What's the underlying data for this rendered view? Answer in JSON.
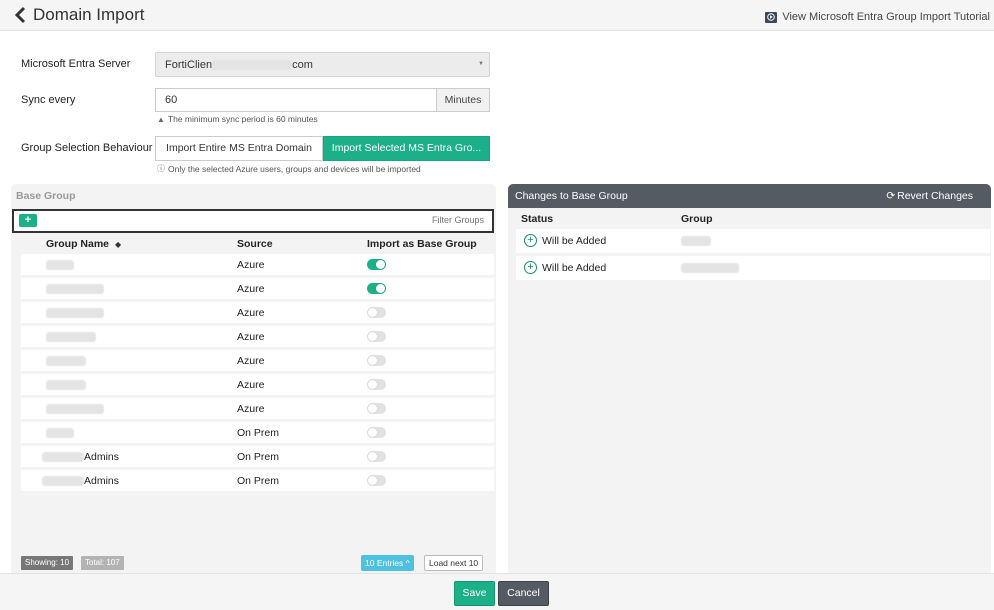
{
  "header": {
    "title": "Domain Import",
    "tutorial_link": "View Microsoft Entra Group Import Tutorial"
  },
  "form": {
    "server_label": "Microsoft Entra Server",
    "server_value_prefix": "FortiClien",
    "server_value_suffix": "com",
    "sync_label": "Sync every",
    "sync_value": "60",
    "sync_unit": "Minutes",
    "sync_hint": "The minimum sync period is 60 minutes",
    "behaviour_label": "Group Selection Behaviour",
    "behaviour_options": [
      "Import Entire MS Entra Domain",
      "Import Selected MS Entra Gro..."
    ],
    "behaviour_selected": "Import Selected MS Entra Gro...",
    "behaviour_hint": "Only the selected Azure users, groups and devices will be imported"
  },
  "base_group": {
    "title": "Base Group",
    "filter_placeholder": "Filter Groups",
    "columns": [
      "Group Name",
      "Source",
      "Import as Base Group"
    ],
    "rows": [
      {
        "name": "",
        "source": "Azure",
        "import": true
      },
      {
        "name": "",
        "source": "Azure",
        "import": true
      },
      {
        "name": "",
        "source": "Azure",
        "import": false
      },
      {
        "name": "",
        "source": "Azure",
        "import": false
      },
      {
        "name": "",
        "source": "Azure",
        "import": false
      },
      {
        "name": "",
        "source": "Azure",
        "import": false
      },
      {
        "name": "",
        "source": "Azure",
        "import": false
      },
      {
        "name": "",
        "source": "On Prem",
        "import": false
      },
      {
        "name": "Admins",
        "source": "On Prem",
        "import": false
      },
      {
        "name": "Admins",
        "source": "On Prem",
        "import": false
      }
    ],
    "showing": "Showing: 10",
    "total": "Total: 107",
    "entries": "10 Entries",
    "load_next": "Load next 10"
  },
  "changes": {
    "title": "Changes to Base Group",
    "revert": "Revert Changes",
    "columns": [
      "Status",
      "Group"
    ],
    "rows": [
      {
        "status": "Will be Added",
        "group": ""
      },
      {
        "status": "Will be Added",
        "group": ""
      }
    ]
  },
  "footer": {
    "save": "Save",
    "cancel": "Cancel"
  },
  "colors": {
    "accent": "#1bb088",
    "dark": "#545b62",
    "info": "#4fc1e0"
  },
  "icons": {
    "back": "chevron-left-icon",
    "tutorial": "play-icon",
    "hint": "warning-icon",
    "info": "info-icon",
    "add": "plus-icon",
    "sort": "sort-icon",
    "revert": "refresh-icon",
    "added": "plus-circle-icon"
  }
}
